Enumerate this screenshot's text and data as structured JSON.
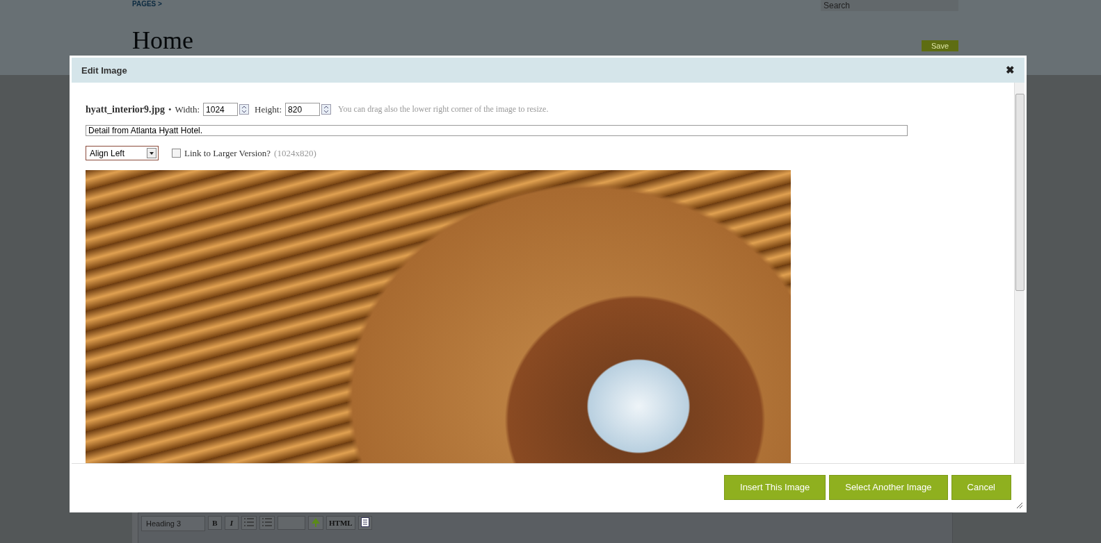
{
  "page": {
    "breadcrumb": "PAGES >",
    "search": {
      "placeholder": "Search"
    },
    "title": "Home",
    "save_button": "Save",
    "editor_toolbar": {
      "format": "Heading 3",
      "buttons": [
        {
          "kind": "bold",
          "label": "B",
          "disabled": false
        },
        {
          "kind": "italic",
          "label": "I",
          "disabled": false
        },
        {
          "kind": "bullets",
          "disabled": false
        },
        {
          "kind": "numbers",
          "disabled": false
        },
        {
          "kind": "blank",
          "disabled": true
        },
        {
          "kind": "image",
          "disabled": false
        },
        {
          "kind": "html",
          "label": "HTML",
          "disabled": false
        },
        {
          "kind": "source",
          "disabled": false
        }
      ]
    }
  },
  "dialog": {
    "title": "Edit Image",
    "close": "✖",
    "filename": "hyatt_interior9.jpg",
    "separator": "•",
    "width": {
      "label": "Width:",
      "value": "1024"
    },
    "height": {
      "label": "Height:",
      "value": "820"
    },
    "hint": "You can drag also the lower right corner of the image to resize.",
    "caption": "Detail from Atlanta Hyatt Hotel.",
    "align": "Align Left",
    "link_larger": {
      "label": "Link to Larger Version?",
      "checked": false,
      "note": "(1024x820)"
    },
    "buttons": [
      "Insert This Image",
      "Select Another Image",
      "Cancel"
    ]
  }
}
